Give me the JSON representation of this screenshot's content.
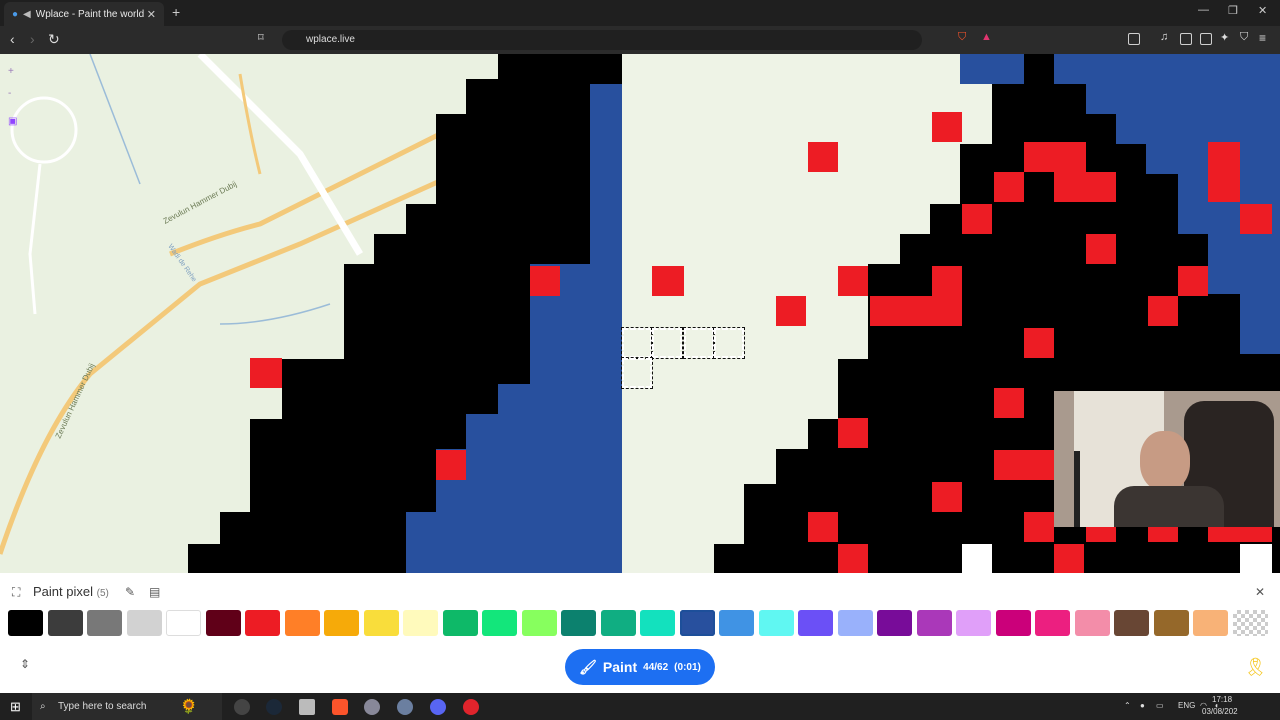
{
  "browser": {
    "tab_title": "Wplace - Paint the world",
    "url": "wplace.live"
  },
  "map": {
    "street_labels": [
      "Zevulun Hammer Dubij",
      "Zevulun Hammer Dubij"
    ],
    "place_label": "Wadi de Rehe"
  },
  "panel": {
    "title": "Paint pixel",
    "count": "(5)",
    "paint_label": "Paint",
    "paint_progress": "44/62",
    "paint_timer": "(0:01)",
    "palette": [
      "#000000",
      "#3c3c3c",
      "#787878",
      "#d2d2d2",
      "#ffffff",
      "#600018",
      "#ed1c24",
      "#ff7f27",
      "#f6aa09",
      "#f9dd3b",
      "#fffabc",
      "#0eb968",
      "#13e67b",
      "#87ff5e",
      "#0c816e",
      "#10ae82",
      "#13e1be",
      "#28509e",
      "#4093e4",
      "#60f7f2",
      "#6b50f6",
      "#99b1fb",
      "#780c99",
      "#aa38b9",
      "#e09ff9",
      "#cb007a",
      "#ec1f80",
      "#f38da9",
      "#684634",
      "#95682a",
      "#f8b277",
      "transparent"
    ],
    "selected_color": "#28509e"
  },
  "taskbar": {
    "search_placeholder": "Type here to search",
    "lang": "ENG",
    "time": "17:18",
    "date": "03/08/202"
  }
}
